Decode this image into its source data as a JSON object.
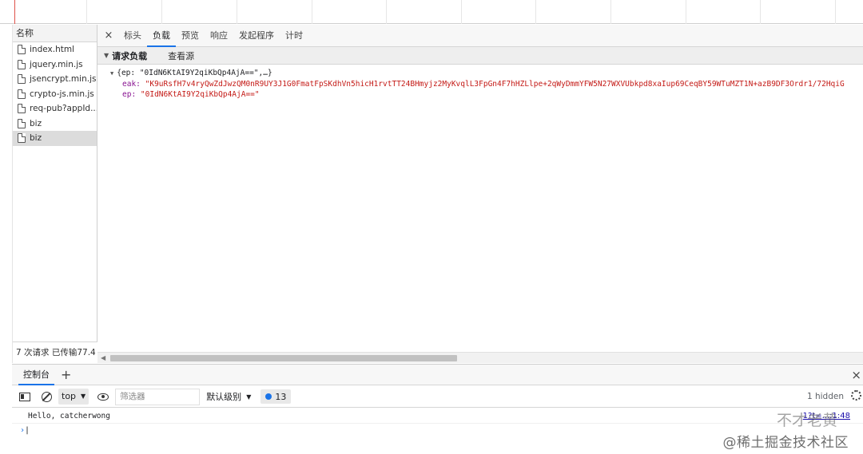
{
  "network_list": {
    "header": "名称",
    "requests": [
      "index.html",
      "jquery.min.js",
      "jsencrypt.min.js",
      "crypto-js.min.js",
      "req-pub?appId...",
      "biz",
      "biz"
    ],
    "selected_index": 6,
    "footer": "7 次请求  已传输77.4"
  },
  "details": {
    "close_glyph": "×",
    "tabs": [
      "标头",
      "负载",
      "预览",
      "响应",
      "发起程序",
      "计时"
    ],
    "active_tab": "负载",
    "section": {
      "toggle": "▼",
      "title": "请求负载",
      "view_source": "查看源"
    },
    "payload": {
      "summary": "{ep: \"0IdN6KtAI9Y2qiKbQp4AjA==\",…}",
      "eak_key": "eak:",
      "eak_value": "\"K9uRsfH7v4ryQwZdJwzQM0nR9UY3J1G0FmatFpSKdhVn5hicH1rvtTT24BHmyjz2MyKvqlL3FpGn4F7hHZLlpe+2qWyDmmYFW5N27WXVUbkpd8xaIup69CeqBY59WTuMZT1N+azB9DF3Ordr1/72HqiG",
      "ep_key": "ep:",
      "ep_value": "\"0IdN6KtAI9Y2qiKbQp4AjA==\""
    }
  },
  "drawer": {
    "tab": "控制台",
    "add_glyph": "+",
    "close_glyph": "×"
  },
  "console_toolbar": {
    "context": "top",
    "filter_placeholder": "筛选器",
    "level": "默认级别",
    "issues_count": "13",
    "hidden": "1 hidden"
  },
  "console": {
    "log_text": "Hello, catcherwong",
    "log_source": "1?t=...:1:48",
    "prompt": "›"
  },
  "watermark": {
    "line1": "不才老黄",
    "line2": "@稀土掘金技术社区"
  }
}
